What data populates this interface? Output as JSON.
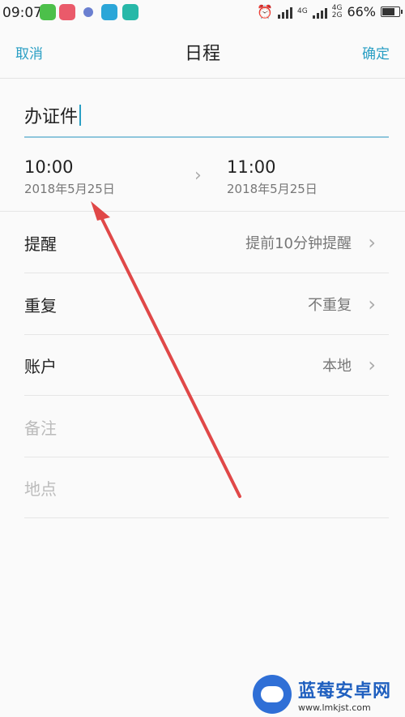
{
  "status_bar": {
    "time": "09:07",
    "battery": "66%",
    "network_labels": [
      "4G",
      "4G",
      "2G"
    ]
  },
  "header": {
    "cancel": "取消",
    "title": "日程",
    "confirm": "确定"
  },
  "event": {
    "title": "办证件"
  },
  "schedule": {
    "start_time": "10:00",
    "start_date": "2018年5月25日",
    "end_time": "11:00",
    "end_date": "2018年5月25日"
  },
  "rows": [
    {
      "label": "提醒",
      "value": "提前10分钟提醒"
    },
    {
      "label": "重复",
      "value": "不重复"
    },
    {
      "label": "账户",
      "value": "本地"
    }
  ],
  "placeholders": {
    "notes": "备注",
    "location": "地点"
  },
  "watermark": {
    "name": "蓝莓安卓网",
    "url": "www.lmkjst.com"
  },
  "colors": {
    "accent": "#2a9fc4",
    "annotation_arrow": "#e04848"
  }
}
